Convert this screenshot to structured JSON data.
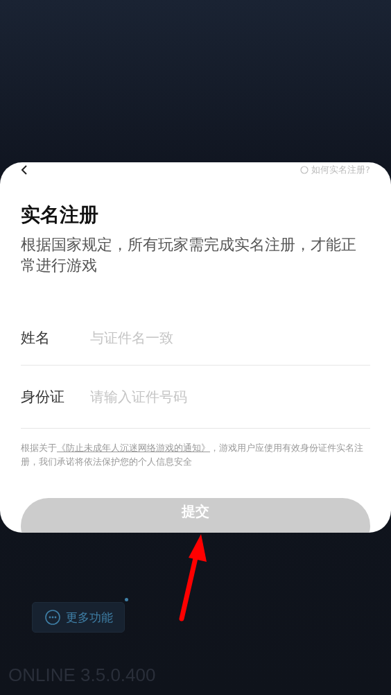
{
  "sheet": {
    "help_link": "如何实名注册?",
    "title": "实名注册",
    "subtitle": "根据国家规定，所有玩家需完成实名注册，才能正常进行游戏",
    "fields": [
      {
        "label": "姓名",
        "placeholder": "与证件名一致"
      },
      {
        "label": "身份证",
        "placeholder": "请输入证件号码"
      }
    ],
    "notice": {
      "before": "根据关于",
      "link": "《防止未成年人沉迷网络游戏的通知》",
      "after": "，游戏用户应使用有效身份证件实名注册，我们承诺将依法保护您的个人信息安全"
    },
    "submit": {
      "label": "提交",
      "disabled": true
    }
  },
  "background": {
    "more_button": {
      "label": "更多功能",
      "badge": true
    },
    "version": "ONLINE 3.5.0.400"
  }
}
